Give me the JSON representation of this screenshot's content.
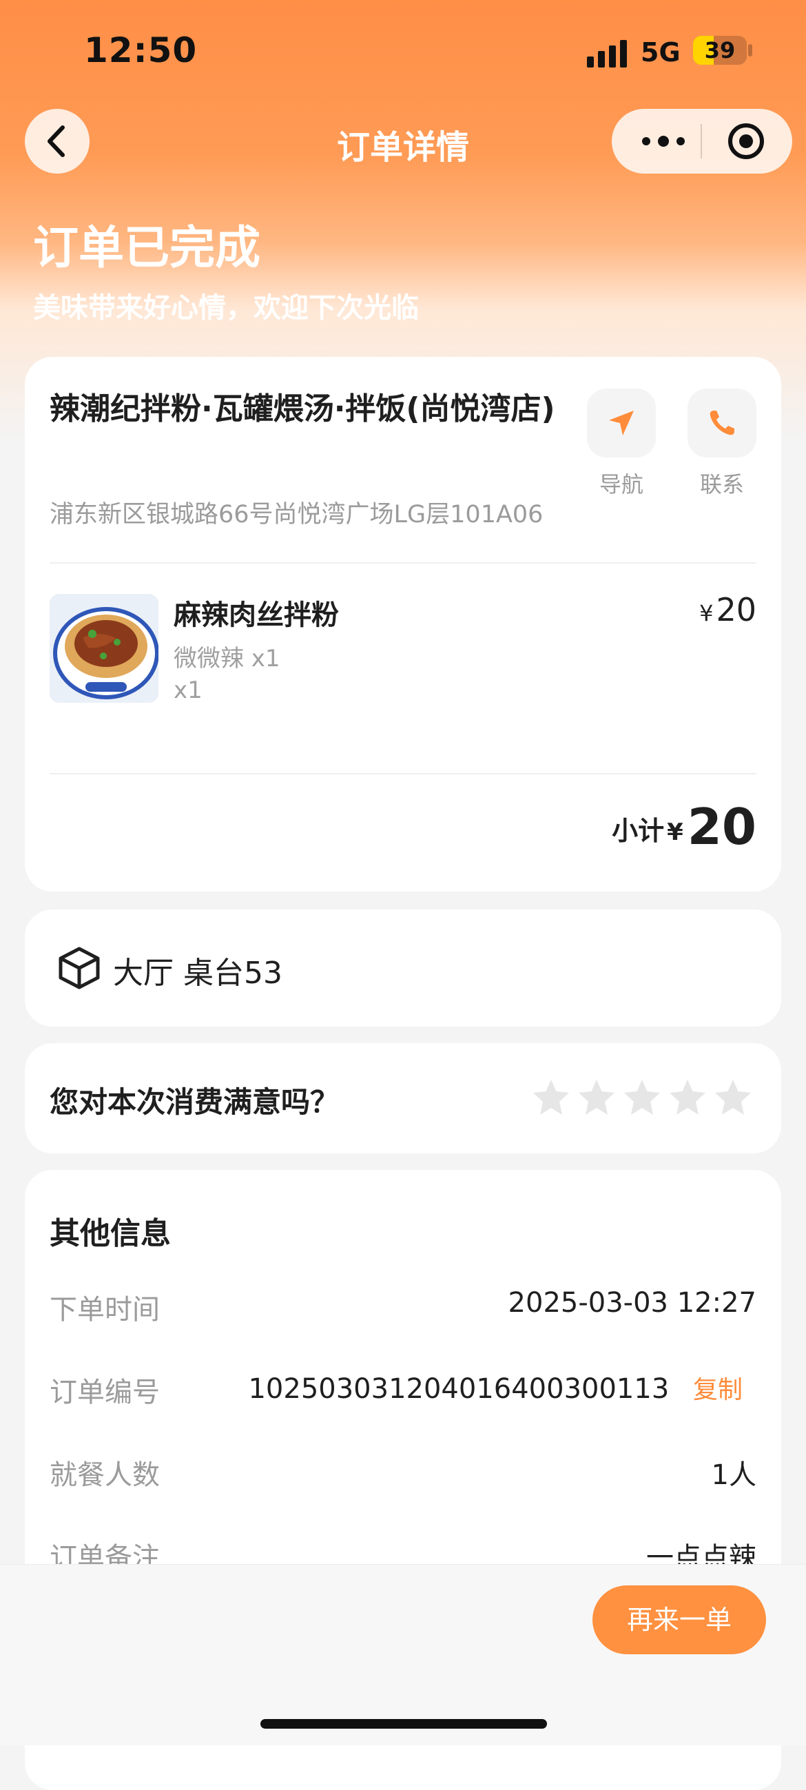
{
  "status_bar": {
    "time": "12:50",
    "network": "5G",
    "battery": "39",
    "battery_fraction": 0.39
  },
  "nav": {
    "title": "订单详情",
    "back_icon": "chevron-left-icon",
    "more_icon": "more-dots-icon",
    "target_icon": "target-icon"
  },
  "hero": {
    "title": "订单已完成",
    "subtitle": "美味带来好心情，欢迎下次光临"
  },
  "store": {
    "name": "辣潮纪拌粉·瓦罐煨汤·拌饭(尚悦湾店)",
    "address": "浦东新区银城路66号尚悦湾广场LG层101A06",
    "nav_label": "导航",
    "contact_label": "联系",
    "nav_icon": "navigation-arrow-icon",
    "contact_icon": "phone-icon"
  },
  "order_items": [
    {
      "name": "麻辣肉丝拌粉",
      "spec": "微微辣 x1",
      "qty": "x1",
      "currency": "¥",
      "price": "20"
    }
  ],
  "subtotal": {
    "label": "小计",
    "currency": "¥",
    "amount": "20"
  },
  "table": {
    "text": "大厅 桌台53",
    "icon": "cube-icon"
  },
  "rating": {
    "question": "您对本次消费满意吗？",
    "stars_total": 5,
    "stars_selected": 0
  },
  "other_info": {
    "title": "其他信息",
    "rows": [
      {
        "label": "下单时间",
        "value": "2025-03-03 12:27"
      },
      {
        "label": "订单编号",
        "value": "102503031204016400300113",
        "action": "复制"
      },
      {
        "label": "就餐人数",
        "value": "1人"
      },
      {
        "label": "订单备注",
        "value": "一点点辣"
      }
    ]
  },
  "bottom": {
    "reorder_label": "再来一单"
  },
  "colors": {
    "accent": "#ff9140",
    "gradient_top": "#ff8e47"
  }
}
